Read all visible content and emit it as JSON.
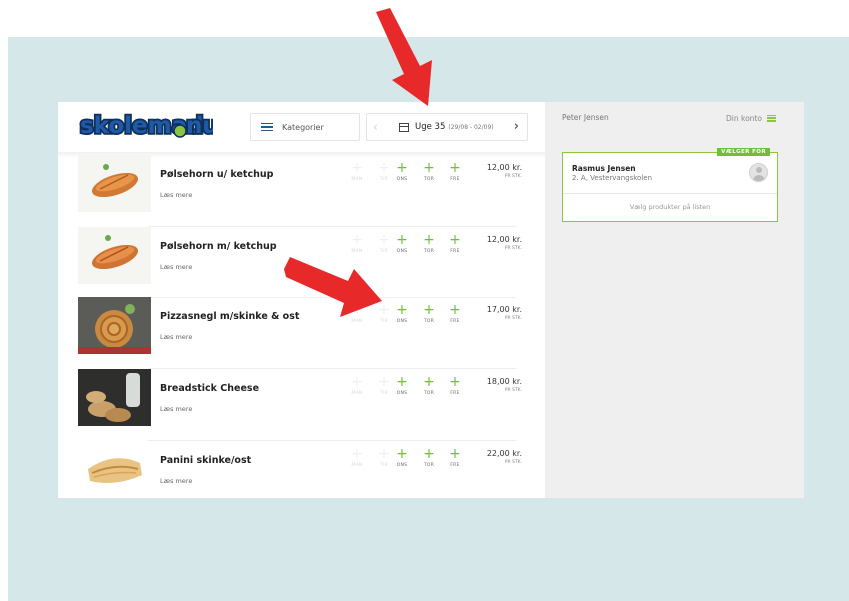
{
  "header": {
    "logo_text": "skolemad.nu",
    "category_label": "Kategorier",
    "week_label": "Uge 35",
    "week_range": "(29/08 - 02/09)"
  },
  "day_labels": [
    "MAN",
    "TIR",
    "ONS",
    "TOR",
    "FRE"
  ],
  "products": [
    {
      "name": "Pølsehorn u/ ketchup",
      "more": "Læs mere",
      "price": "12,00 kr.",
      "unit": "PR STK."
    },
    {
      "name": "Pølsehorn m/ ketchup",
      "more": "Læs mere",
      "price": "12,00 kr.",
      "unit": "PR STK."
    },
    {
      "name": "Pizzasnegl m/skinke & ost",
      "more": "Læs mere",
      "price": "17,00 kr.",
      "unit": "PR STK."
    },
    {
      "name": "Breadstick Cheese",
      "more": "Læs mere",
      "price": "18,00 kr.",
      "unit": "PR STK."
    },
    {
      "name": "Panini skinke/ost",
      "more": "Læs mere",
      "price": "22,00 kr.",
      "unit": "PR STK."
    }
  ],
  "sidebar": {
    "user_name": "Peter Jensen",
    "account_label": "Din konto",
    "card": {
      "badge": "VÆLGER FOR",
      "child_name": "Rasmus Jensen",
      "child_school": "2. A, Vestervangskolen",
      "hint": "Vælg produkter på listen"
    }
  },
  "colors": {
    "accent_green": "#6fbf3a",
    "background": "#d6e7ea",
    "arrow": "#e8292a"
  }
}
